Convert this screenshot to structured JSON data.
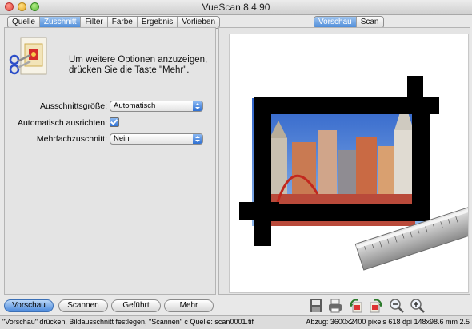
{
  "window": {
    "title": "VueScan 8.4.90"
  },
  "left_tabs": [
    "Quelle",
    "Zuschnitt",
    "Filter",
    "Farbe",
    "Ergebnis",
    "Vorlieben"
  ],
  "right_tabs": [
    "Vorschau",
    "Scan"
  ],
  "active_left_tab": "Zuschnitt",
  "active_right_tab": "Vorschau",
  "info": {
    "line1": "Um weitere Optionen anzuzeigen,",
    "line2": "drücken Sie die Taste \"Mehr\"."
  },
  "settings": {
    "crop_size_label": "Ausschnittsgröße:",
    "crop_size_value": "Automatisch",
    "auto_align_label": "Automatisch ausrichten:",
    "auto_align_checked": true,
    "multi_crop_label": "Mehrfachzuschnitt:",
    "multi_crop_value": "Nein"
  },
  "buttons": {
    "preview": "Vorschau",
    "scan": "Scannen",
    "guided": "Geführt",
    "more": "Mehr"
  },
  "toolbar_icons": [
    "save-icon",
    "print-icon",
    "rotate-left-icon",
    "rotate-right-icon",
    "zoom-out-icon",
    "zoom-in-icon"
  ],
  "status": {
    "left": "\"Vorschau\" drücken, Bildausschnitt festlegen, \"Scannen\" c  Quelle: scan0001.tif",
    "right": "Abzug: 3600x2400 pixels 618 dpi 148x98.6 mm 2.5"
  },
  "colors": {
    "accent": "#4a89dc",
    "crop_frame": "#000000"
  }
}
